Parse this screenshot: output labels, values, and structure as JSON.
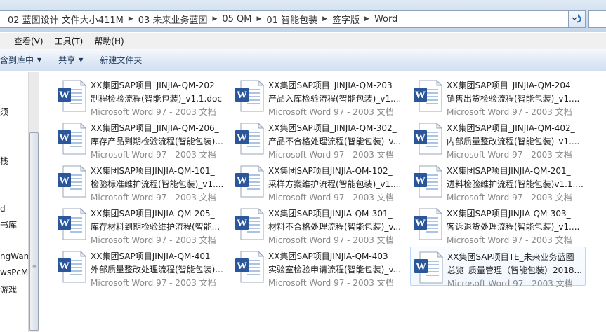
{
  "address": {
    "crumbs": [
      "02 蓝图设计 文件大小411M",
      "03 未来业务蓝图",
      "05 QM",
      "01 智能包装",
      "签字版",
      "Word"
    ]
  },
  "menu": {
    "items": [
      "查看(V)",
      "工具(T)",
      "帮助(H)"
    ]
  },
  "commands": {
    "include_library": "含到库中",
    "share": "共享",
    "new_folder": "新建文件夹"
  },
  "nav": {
    "items": [
      "须",
      "栈",
      "d",
      "书库",
      "ngWan",
      "wsPcMa",
      "游戏"
    ]
  },
  "colors": {
    "accent": "#2b579a",
    "selection_border": "#b8d6fb",
    "file_type_text": "#8a8a8a"
  },
  "files": [
    {
      "line1": "XX集团SAP项目_JINJIA-QM-202_",
      "line2": "制程检验流程(智能包装)_v1.1.doc",
      "type": "Microsoft Word 97 - 2003 文档",
      "icon": "word-document-icon"
    },
    {
      "line1": "XX集团SAP项目_JINJIA-QM-203_",
      "line2": "产品入库检验流程(智能包装)_v1....",
      "type": "Microsoft Word 97 - 2003 文档",
      "icon": "word-document-icon"
    },
    {
      "line1": "XX集团SAP项目_JINJIA-QM-204_",
      "line2": "销售出货检验流程(智能包装)_v1....",
      "type": "Microsoft Word 97 - 2003 文档",
      "icon": "word-document-icon"
    },
    {
      "line1": "XX集团SAP项目_JINJIA-QM-206_",
      "line2": "库存产品到期检验流程(智能包装)...",
      "type": "Microsoft Word 97 - 2003 文档",
      "icon": "word-document-icon"
    },
    {
      "line1": "XX集团SAP项目_JINJIA-QM-302_",
      "line2": "产品不合格处理流程(智能包装)_v...",
      "type": "Microsoft Word 97 - 2003 文档",
      "icon": "word-document-icon"
    },
    {
      "line1": "XX集团SAP项目_JINJIA-QM-402_",
      "line2": "内部质量整改流程(智能包装)_v1....",
      "type": "Microsoft Word 97 - 2003 文档",
      "icon": "word-document-icon"
    },
    {
      "line1": "XX集团SAP项目JINJIA-QM-101_",
      "line2": "检验标准维护流程(智能包装)_v1....",
      "type": "Microsoft Word 97 - 2003 文档",
      "icon": "word-document-icon"
    },
    {
      "line1": "XX集团SAP项目JINJIA-QM-102_",
      "line2": "采样方案维护流程(智能包装)_v1....",
      "type": "Microsoft Word 97 - 2003 文档",
      "icon": "word-document-icon"
    },
    {
      "line1": "XX集团SAP项目JINJIA-QM-201_",
      "line2": "进料检验维护流程(智能包装)v1.1....",
      "type": "Microsoft Word 97 - 2003 文档",
      "icon": "word-document-icon"
    },
    {
      "line1": "XX集团SAP项目JINJIA-QM-205_",
      "line2": "库存材料到期检验维护流程(智能...",
      "type": "Microsoft Word 97 - 2003 文档",
      "icon": "word-document-icon"
    },
    {
      "line1": "XX集团SAP项目JINJIA-QM-301_",
      "line2": "材料不合格处理流程(智能包装)_v...",
      "type": "Microsoft Word 97 - 2003 文档",
      "icon": "word-document-icon"
    },
    {
      "line1": "XX集团SAP项目JINJIA-QM-303_",
      "line2": "客诉退货处理流程(智能包装)_v1....",
      "type": "Microsoft Word 97 - 2003 文档",
      "icon": "word-document-icon"
    },
    {
      "line1": "XX集团SAP项目JINJIA-QM-401_",
      "line2": "外部质量整改处理流程(智能包装)...",
      "type": "Microsoft Word 97 - 2003 文档",
      "icon": "word-document-icon"
    },
    {
      "line1": "XX集团SAP项目JINJIA-QM-403_",
      "line2": "实验室检验申请流程(智能包装)_v...",
      "type": "Microsoft Word 97 - 2003 文档",
      "icon": "word-document-icon"
    },
    {
      "line1": "XX集团SAP项目TE_未来业务蓝图",
      "line2": "总览_质量管理（智能包装）2018...",
      "type": "Microsoft Word 97 - 2003 文档",
      "icon": "word-document-icon",
      "selected": true
    }
  ]
}
